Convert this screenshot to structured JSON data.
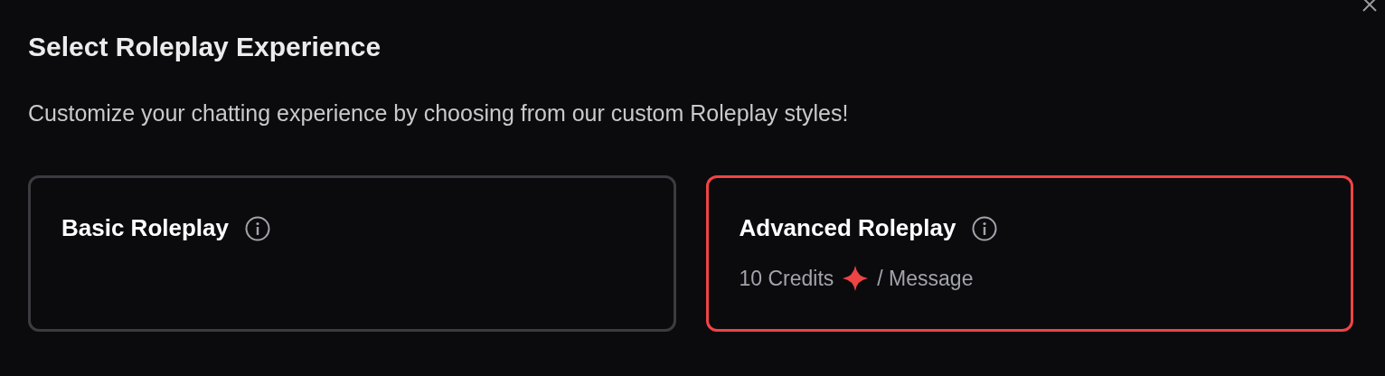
{
  "dialog": {
    "title": "Select Roleplay Experience",
    "subtitle": "Customize your chatting experience by choosing from our custom Roleplay styles!"
  },
  "options": [
    {
      "label": "Basic Roleplay",
      "selected": false
    },
    {
      "label": "Advanced Roleplay",
      "selected": true,
      "cost": "10 Credits",
      "per": "/ Message"
    }
  ]
}
